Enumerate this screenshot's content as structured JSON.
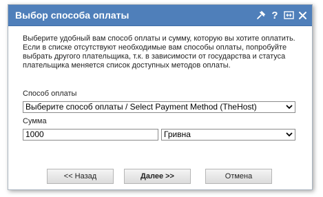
{
  "dialog": {
    "title": "Выбор способа оплаты",
    "icons": [
      "pin-icon",
      "help-icon",
      "resize-icon",
      "close-icon"
    ],
    "description": "Выберите удобный вам способ оплаты и сумму, которую вы хотите оплатить. Если в списке отсутствуют необходимые вам способы оплаты, попробуйте выбрать другого плательщика, т.к. в зависимости от государства и статуса плательщика меняется список доступных методов оплаты.",
    "colors": {
      "titlebar": "#4f7fba",
      "title_text": "#ffffff"
    }
  },
  "payment_method": {
    "label": "Способ оплаты",
    "selected": "Выберите способ оплаты / Select Payment Method (TheHost)"
  },
  "amount": {
    "label": "Сумма",
    "value": "1000",
    "currency_selected": "Гривна"
  },
  "buttons": {
    "back": "<< Назад",
    "next": "Далее >>",
    "cancel": "Отмена"
  }
}
